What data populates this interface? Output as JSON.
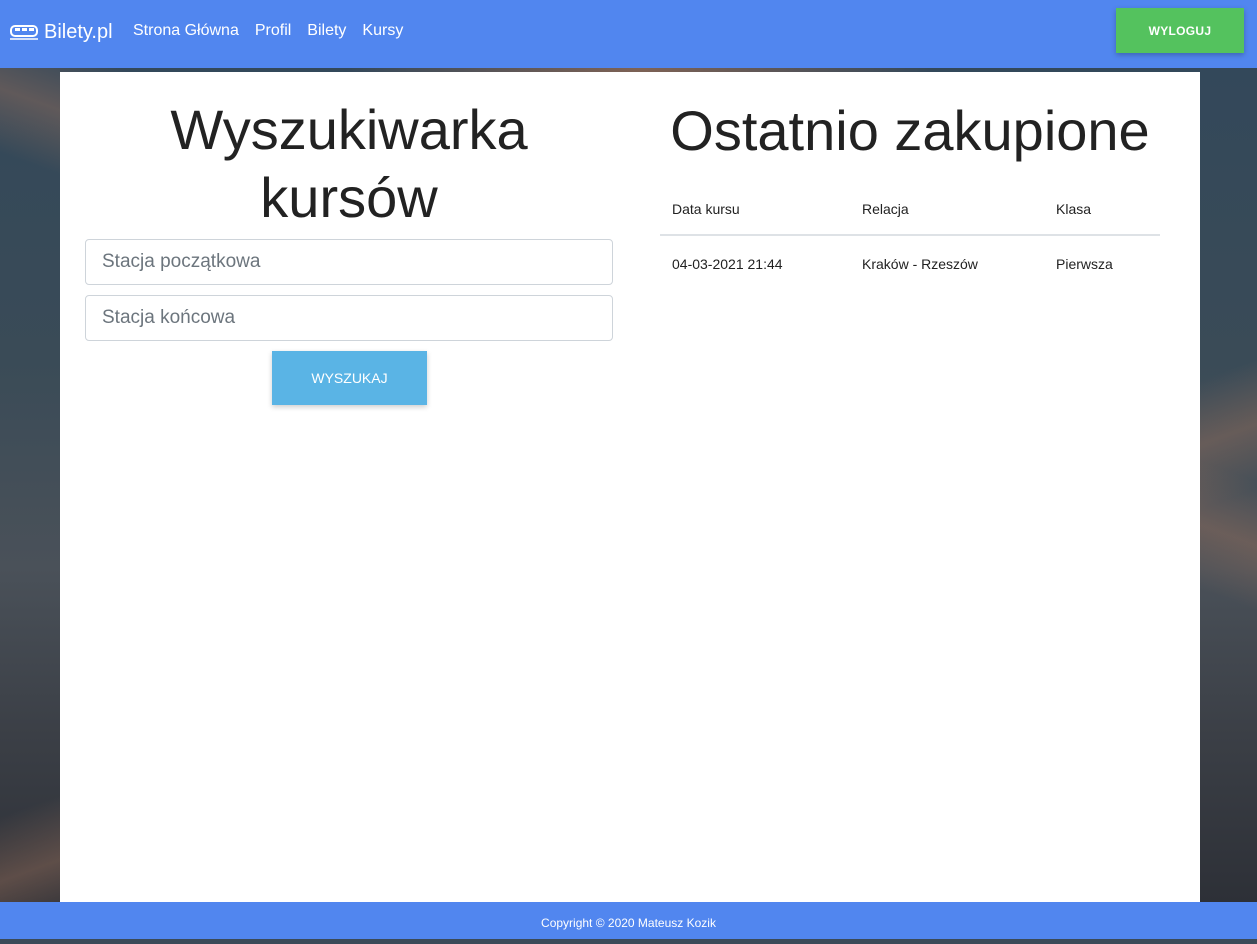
{
  "navbar": {
    "brand": "Bilety.pl",
    "links": [
      "Strona Główna",
      "Profil",
      "Bilety",
      "Kursy"
    ],
    "logout_label": "WYLOGUJ",
    "brand_icon": "train-icon"
  },
  "search": {
    "title_line1": "Wyszukiwarka",
    "title_line2": "kursów",
    "start_placeholder": "Stacja początkowa",
    "end_placeholder": "Stacja końcowa",
    "button_label": "WYSZUKAJ"
  },
  "recent": {
    "title": "Ostatnio zakupione",
    "headers": [
      "Data kursu",
      "Relacja",
      "Klasa"
    ],
    "rows": [
      [
        "04-03-2021 21:44",
        "Kraków - Rzeszów",
        "Pierwsza"
      ]
    ]
  },
  "footer": {
    "text": "Copyright © 2020 Mateusz Kozik"
  },
  "colors": {
    "nav": "#5186ef",
    "logout": "#54c25e",
    "search_button": "#5ab4e5"
  }
}
